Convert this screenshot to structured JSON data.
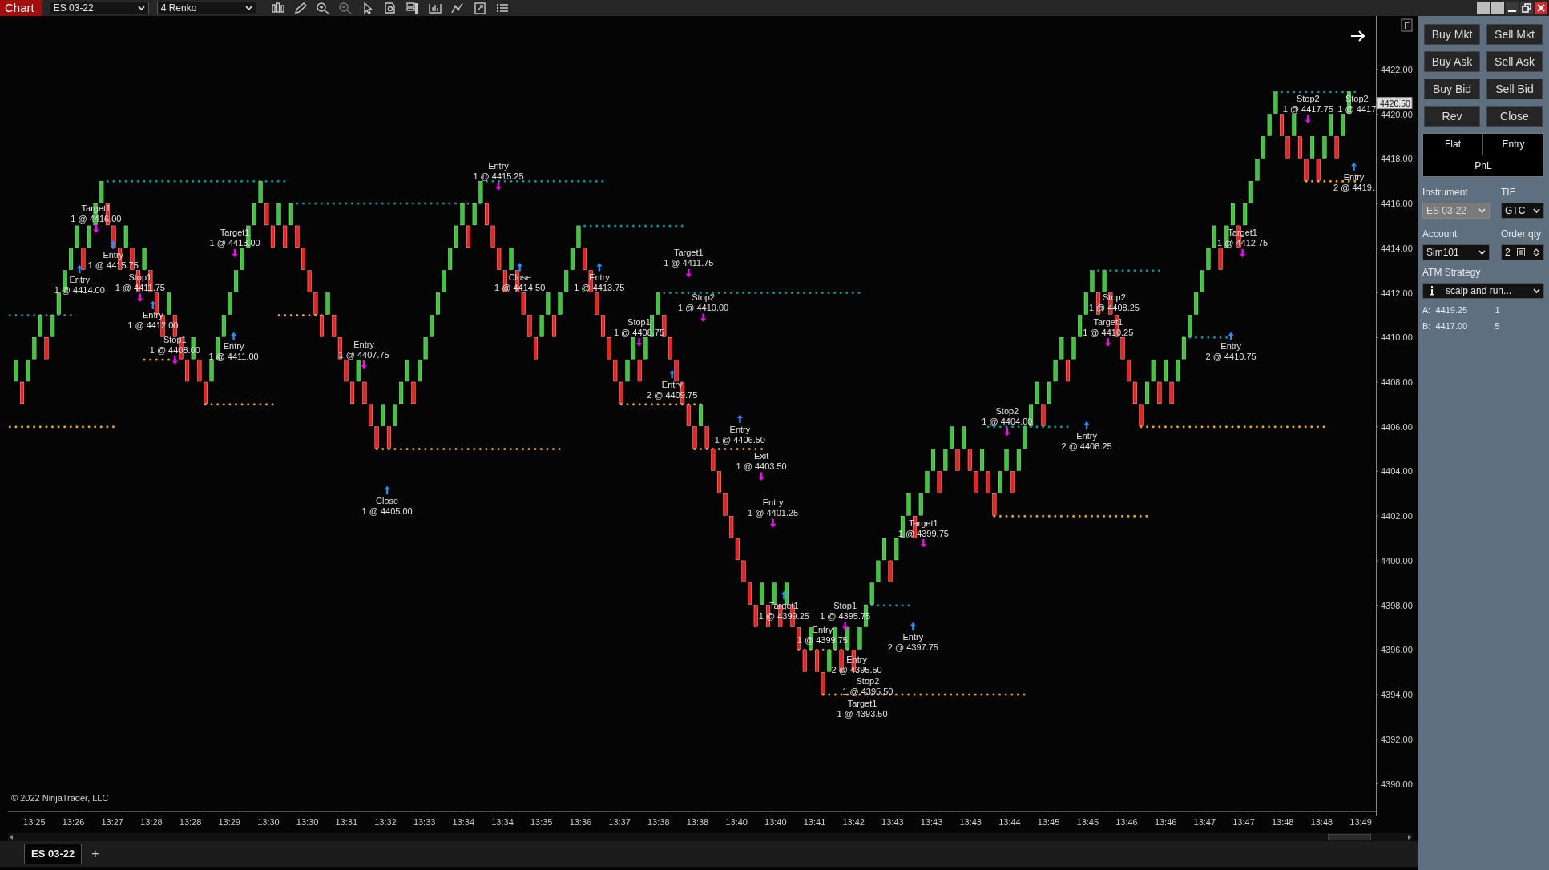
{
  "toolbar": {
    "title": "Chart",
    "instrument": "ES 03-22",
    "bar_type": "4 Renko"
  },
  "chart": {
    "copyright": "© 2022 NinjaTrader, LLC",
    "freeze_button": "F",
    "price_marker": "4420.50",
    "price_axis": [
      "4422.00",
      "4420.00",
      "4418.00",
      "4416.00",
      "4414.00",
      "4412.00",
      "4410.00",
      "4408.00",
      "4406.00",
      "4404.00",
      "4402.00",
      "4400.00",
      "4398.00",
      "4396.00",
      "4394.00",
      "4392.00",
      "4390.00"
    ],
    "time_axis": [
      "13:25",
      "13:26",
      "13:27",
      "13:28",
      "13:28",
      "13:29",
      "13:30",
      "13:30",
      "13:31",
      "13:32",
      "13:33",
      "13:34",
      "13:34",
      "13:35",
      "13:36",
      "13:37",
      "13:38",
      "13:38",
      "13:40",
      "13:40",
      "13:41",
      "13:42",
      "13:43",
      "13:43",
      "13:43",
      "13:44",
      "13:45",
      "13:45",
      "13:46",
      "13:46",
      "13:47",
      "13:47",
      "13:48",
      "13:48",
      "13:49"
    ],
    "executions": [
      {
        "label": "Target1",
        "text": "1 @ 4416.00",
        "kind": "sell"
      },
      {
        "label": "Entry",
        "text": "1 @ 4415.75",
        "kind": "buy"
      },
      {
        "label": "Entry",
        "text": "1 @ 4414.00",
        "kind": "buy"
      },
      {
        "label": "Stop1",
        "text": "1 @ 4411.75",
        "kind": "sell"
      },
      {
        "label": "Entry",
        "text": "1 @ 4412.00",
        "kind": "buy"
      },
      {
        "label": "Stop1",
        "text": "1 @ 4408.00",
        "kind": "sell"
      },
      {
        "label": "Target1",
        "text": "1 @ 4413.00",
        "kind": "sell"
      },
      {
        "label": "Entry",
        "text": "1 @ 4411.00",
        "kind": "buy"
      },
      {
        "label": "Entry",
        "text": "1 @ 4407.75",
        "kind": "sell"
      },
      {
        "label": "Close",
        "text": "1 @ 4405.00",
        "kind": "buy"
      },
      {
        "label": "Entry",
        "text": "1 @ 4415.25",
        "kind": "sell"
      },
      {
        "label": "Close",
        "text": "1 @ 4414.50",
        "kind": "buy"
      },
      {
        "label": "Entry",
        "text": "1 @ 4413.75",
        "kind": "buy"
      },
      {
        "label": "Target1",
        "text": "1 @ 4411.75",
        "kind": "sell"
      },
      {
        "label": "Stop2",
        "text": "1 @ 4410.00",
        "kind": "sell"
      },
      {
        "label": "Stop1",
        "text": "1 @ 4408.75",
        "kind": "sell"
      },
      {
        "label": "Entry",
        "text": "2 @ 4409.75",
        "kind": "buy"
      },
      {
        "label": "Entry",
        "text": "1 @ 4406.50",
        "kind": "buy"
      },
      {
        "label": "Exit",
        "text": "1 @ 4403.50",
        "kind": "sell"
      },
      {
        "label": "Entry",
        "text": "1 @ 4401.25",
        "kind": "sell"
      },
      {
        "label": "Target1",
        "text": "1 @ 4399.25",
        "kind": "buy"
      },
      {
        "label": "Stop1",
        "text": "1 @ 4395.75",
        "kind": "sell"
      },
      {
        "label": "Entry",
        "text": "1 @ 4399.75",
        "kind": "plain"
      },
      {
        "label": "Entry",
        "text": "2 @ 4395.50",
        "kind": "plain"
      },
      {
        "label": "Stop2",
        "text": "1 @ 4395.50",
        "kind": "plain"
      },
      {
        "label": "Target1",
        "text": "1 @ 4393.50",
        "kind": "plain"
      },
      {
        "label": "Target1",
        "text": "1 @ 4399.75",
        "kind": "sell"
      },
      {
        "label": "Entry",
        "text": "2 @ 4397.75",
        "kind": "buy"
      },
      {
        "label": "Stop2",
        "text": "1 @ 4404.00",
        "kind": "sell"
      },
      {
        "label": "Stop2",
        "text": "1 @ 4408.25",
        "kind": "plain"
      },
      {
        "label": "Target1",
        "text": "1 @ 4410.25",
        "kind": "sell"
      },
      {
        "label": "Entry",
        "text": "2 @ 4408.25",
        "kind": "buy"
      },
      {
        "label": "Target1",
        "text": "1 @ 4412.75",
        "kind": "sell"
      },
      {
        "label": "Entry",
        "text": "2 @ 4410.75",
        "kind": "buy"
      },
      {
        "label": "Stop2",
        "text": "1 @ 4417.75",
        "kind": "sell"
      },
      {
        "label": "Stop2",
        "text": "1 @ 4417",
        "kind": "plain"
      },
      {
        "label": "Entry",
        "text": "2 @ 4419.",
        "kind": "buy"
      }
    ]
  },
  "chart_tabs": [
    {
      "label": "ES 03-22",
      "selected": true
    }
  ],
  "add_tab": "+",
  "chart_trader": {
    "buttons": [
      "Buy Mkt",
      "Sell Mkt",
      "Buy Ask",
      "Sell Ask",
      "Buy Bid",
      "Sell Bid",
      "Rev",
      "Close"
    ],
    "position": {
      "flat": "Flat",
      "entry": "Entry",
      "pnl": "PnL"
    },
    "instrument": {
      "label": "Instrument",
      "value": "ES 03-22",
      "disabled": true
    },
    "tif": {
      "label": "TIF",
      "value": "GTC"
    },
    "account": {
      "label": "Account",
      "value": "Sim101"
    },
    "quantity": {
      "label": "Order qty",
      "value": "2"
    },
    "atm_strategy": {
      "label": "ATM Strategy",
      "value": "scalp and run..."
    },
    "ask": {
      "label": "A:",
      "price": "4419.25",
      "size": "1"
    },
    "bid": {
      "label": "B:",
      "price": "4417.00",
      "size": "5"
    }
  }
}
